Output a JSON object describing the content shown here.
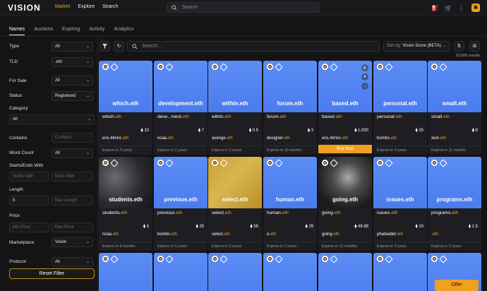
{
  "app": {
    "logo": "VISION"
  },
  "nav": {
    "market": "Market",
    "explore": "Explore",
    "search": "Search"
  },
  "topsearch": {
    "placeholder": "Search"
  },
  "tabs": [
    "Names",
    "Auctions",
    "Expiring",
    "Activity",
    "Analytics"
  ],
  "filters": {
    "type_label": "Type",
    "type_value": "All",
    "tld_label": "TLD",
    "tld_value": ".eth",
    "forsale_label": "For Sale",
    "forsale_value": "All",
    "status_label": "Status",
    "status_value": "Registered",
    "category_label": "Category",
    "category_value": "All",
    "contains_label": "Contains",
    "contains_placeholder": "Contains",
    "wordcount_label": "Word Count",
    "wordcount_value": "All",
    "startsends_label": "Starts/Ends With",
    "starts_placeholder": "Starts With",
    "ends_placeholder": "Ends With",
    "length_label": "Length",
    "length_min": "5",
    "length_max_placeholder": "Max Length",
    "price_label": "Price",
    "price_min_placeholder": "Min Price",
    "price_max_placeholder": "Max Price",
    "marketplace_label": "Marketplace",
    "marketplace_value": "Vision",
    "protocol_label": "Protocol",
    "protocol_value": "All",
    "reset_label": "Reset Filter"
  },
  "grid_search": {
    "placeholder": "Search..."
  },
  "sort": {
    "label": "Sort by:",
    "value": "Vision Score (BETA)"
  },
  "results": "10,000 results",
  "cards_row1": [
    {
      "img": "which.eth",
      "name": "which",
      "price": "10",
      "owner": "ens.4lmnc",
      "expires": "Expires in 3 years"
    },
    {
      "img": "development.eth",
      "name": "deve...ment",
      "price": "7",
      "owner": "ncaa",
      "expires": "Expires in 2 years"
    },
    {
      "img": "within.eth",
      "name": "within",
      "price": "0.5",
      "owner": "avenge",
      "expires": "Expires in 2 years"
    },
    {
      "img": "forum.eth",
      "name": "forum",
      "price": "3",
      "owner": "designer",
      "expires": "Expires in 10 months"
    },
    {
      "img": "based.eth",
      "name": "based",
      "price": "1,000",
      "owner": "ens.4lmnc",
      "buy": "Buy Now"
    },
    {
      "img": "personal.eth",
      "name": "personal",
      "price": "25",
      "owner": "bombs",
      "expires": "Expires in 4 years"
    },
    {
      "img": "small.eth",
      "name": "small",
      "price": "8",
      "owner": "xion",
      "expires": "Expires in 11 months"
    }
  ],
  "cards_row2": [
    {
      "img": "students.eth",
      "name": "students",
      "price": "3",
      "owner": "ncaa",
      "expires": "Expires in 8 months"
    },
    {
      "img": "previous.eth",
      "name": "previous",
      "price": "25",
      "owner": "bombs",
      "expires": "Expires in 5 years"
    },
    {
      "img": "select.eth",
      "name": "select",
      "price": "55",
      "owner": "select",
      "expires": "Expires in 2 years"
    },
    {
      "img": "human.eth",
      "name": "human",
      "price": "29",
      "owner": "o",
      "expires": "Expires in 3 years"
    },
    {
      "img": "going.eth",
      "name": "going",
      "price": "48.88",
      "owner": "going",
      "expires": "Expires in 12 months"
    },
    {
      "img": "issues.eth",
      "name": "issues",
      "price": "10",
      "owner": "phatwallet",
      "expires": "Expires in 3 years"
    },
    {
      "img": "programs.eth",
      "name": "programs",
      "price": "1.5",
      "owner": "",
      "expires": "Expires in 2 years"
    }
  ],
  "tld_suffix": ".eth",
  "eth_symbol": "⧫",
  "offer_label": "Offer"
}
